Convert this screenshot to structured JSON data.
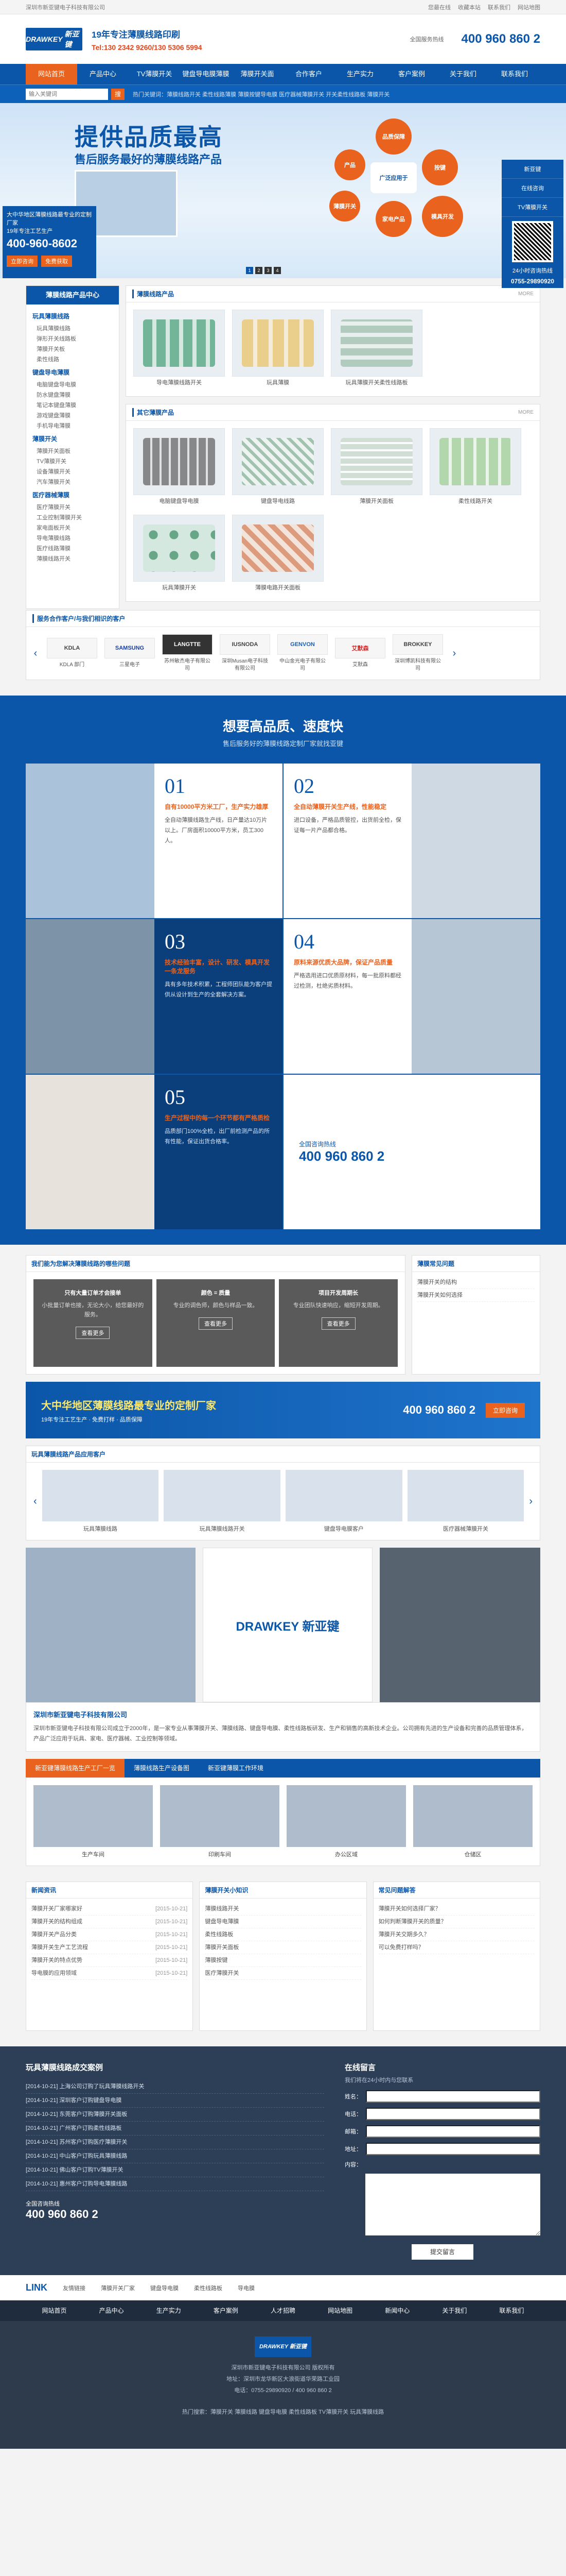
{
  "topbar": {
    "company": "深圳市新亚键电子科技有限公司",
    "links": [
      "您最在线",
      "收藏本站",
      "联系我们",
      "网站地图"
    ]
  },
  "header": {
    "logo": "DRAWKEY",
    "logo_cn": "新亚键",
    "slogan1": "19年专注薄膜线路印刷",
    "slogan2": "Tel:130 2342 9260/130 5306 5994",
    "phone_label": "全国服务热线",
    "phone": "400 960 860 2"
  },
  "nav": [
    "网站首页",
    "产品中心",
    "TV薄膜开关",
    "键盘导电膜薄膜",
    "薄膜开关面",
    "合作客户",
    "生产实力",
    "客户案例",
    "关于我们",
    "联系我们"
  ],
  "search": {
    "placeholder": "输入关键词",
    "button": "搜",
    "hot": "热门关键词：薄膜线路开关 柔性线路薄膜 薄膜按键导电膜 医疗器械薄膜开关 开关柔性线路板 薄膜开关"
  },
  "banner": {
    "title": "提供品质最高",
    "subtitle": "售后服务最好的薄膜线路产品",
    "circles": [
      "品质保障",
      "产品",
      "按键",
      "薄膜开关",
      "模具开发",
      "家电产品",
      "广泛应用于"
    ],
    "dots": [
      "1",
      "2",
      "3",
      "4"
    ]
  },
  "adbox": {
    "line1": "大中华地区薄膜线路最专业的定制厂家",
    "line2": "19年专注工艺生产",
    "phone": "400-960-8602",
    "btn1": "立即咨询",
    "btn2": "免费获取"
  },
  "side": {
    "items": [
      "新亚键",
      "在线咨询",
      "TV薄膜开关"
    ],
    "scan_label": "24小时咨询热线",
    "tel": "0755-29890920"
  },
  "leftcol": {
    "title": "薄膜线路产品中心",
    "groups": [
      {
        "title": "玩具薄膜线路",
        "items": [
          "玩具薄膜线路",
          "弹形开关线路板",
          "薄膜开关板",
          "柔性线路"
        ]
      },
      {
        "title": "键盘导电薄膜",
        "items": [
          "电脑键盘导电膜",
          "防水键盘薄膜",
          "笔记本键盘薄膜",
          "游戏键盘薄膜",
          "手机导电薄膜"
        ]
      },
      {
        "title": "薄膜开关",
        "items": [
          "薄膜开关面板",
          "TV薄膜开关",
          "设备薄膜开关",
          "汽车薄膜开关"
        ]
      },
      {
        "title": "医疗器械薄膜",
        "items": [
          "医疗薄膜开关",
          "工业控制薄膜开关",
          "家电面板开关",
          "导电薄膜线路",
          "医疗线路薄膜",
          "薄膜线路开关"
        ]
      }
    ]
  },
  "products1": {
    "title": "薄膜线路产品",
    "more": "MORE",
    "items": [
      "导电薄膜线路开关",
      "玩具薄膜",
      "玩具薄膜开关柔性线路板"
    ]
  },
  "products2": {
    "title": "其它薄膜产品",
    "more": "MORE",
    "items": [
      "电脑键盘导电膜",
      "键盘导电线路",
      "薄膜开关面板",
      "柔性线路开关",
      "玩具薄膜开关",
      "薄膜电路开关面板"
    ]
  },
  "partners": {
    "title": "服务合作客户/与我们相识的客户",
    "items": [
      {
        "logo": "KDLA",
        "name": "KDLA 部门"
      },
      {
        "logo": "SAMSUNG",
        "name": "三星电子"
      },
      {
        "logo": "LANGTTE",
        "name": "苏州敏杰电子有限公司"
      },
      {
        "logo": "IUSNODA",
        "name": "深圳Musan电子科技有限公司"
      },
      {
        "logo": "GENVON",
        "name": "中山金光电子有限公司"
      },
      {
        "logo": "艾默森",
        "name": "艾默森"
      },
      {
        "logo": "BROKKEY",
        "name": "深圳博凯科技有限公司"
      }
    ]
  },
  "quality": {
    "title": "想要高品质、速度快",
    "subtitle": "售后服务好的薄膜线路定制厂家就找亚键",
    "items": [
      {
        "num": "01",
        "title": "自有10000平方米工厂，生产实力雄厚",
        "desc": "全自动薄膜线路生产线，日产量达10万片以上。厂房面积10000平方米，员工300人。"
      },
      {
        "num": "02",
        "title": "全自动薄膜开关生产线，性能稳定",
        "desc": "进口设备，严格品质管控，出货前全检，保证每一片产品都合格。"
      },
      {
        "num": "03",
        "title": "技术经验丰富，设计、研发、模具开发一条龙服务",
        "desc": "具有多年技术积累，工程师团队能为客户提供从设计到生产的全套解决方案。"
      },
      {
        "num": "04",
        "title": "原料来源优质大品牌，保证产品质量",
        "desc": "严格选用进口优质原材料，每一批原料都经过检测，杜绝劣质材料。"
      },
      {
        "num": "05",
        "title": "生产过程中的每一个环节都有严格质检",
        "desc": "品质部门100%全检，出厂前检测产品的所有性能，保证出货合格率。"
      }
    ],
    "call_label": "全国咨询热线",
    "call_phone": "400 960 860 2"
  },
  "answers": {
    "title": "我们能为您解决薄膜线路的哪些问题",
    "items": [
      {
        "title": "只有大量订单才会接单",
        "desc": "小批量订单也接，无论大小，给您最好的服务。",
        "btn": "查看更多"
      },
      {
        "title": "颜色 = 质量",
        "desc": "专业的调色师，颜色与样品一致。",
        "btn": "查看更多"
      },
      {
        "title": "项目开发周期长",
        "desc": "专业团队快速响应，缩短开发周期。",
        "btn": "查看更多"
      }
    ]
  },
  "news_side": {
    "title": "薄膜常见问题",
    "items": [
      "薄膜开关的结构",
      "薄膜开关如何选择"
    ]
  },
  "strip": {
    "text": "大中华地区薄膜线路最专业的定制厂家",
    "sub": "19年专注工艺生产 · 免费打样 · 品质保障",
    "phone": "400 960 860 2",
    "btn": "立即咨询"
  },
  "cases": {
    "title": "玩具薄膜线路产品应用客户",
    "items": [
      "玩具薄膜线路",
      "玩具薄膜线路开关",
      "键盘导电膜客户",
      "医疗器械薄膜开关"
    ]
  },
  "about": {
    "title": "深圳市新亚键电子科技有限公司",
    "logo": "DRAWKEY 新亚键",
    "text": "深圳市新亚键电子科技有限公司成立于2000年，是一家专业从事薄膜开关、薄膜线路、键盘导电膜、柔性线路板研发、生产和销售的高新技术企业。公司拥有先进的生产设备和完善的品质管理体系，产品广泛应用于玩具、家电、医疗器械、工业控制等领域。"
  },
  "factory": {
    "tabs": [
      "新亚键薄膜线路生产工厂一览",
      "薄膜线路生产设备图",
      "新亚键薄膜工作环境"
    ],
    "items": [
      "生产车间",
      "印刷车间",
      "办公区域",
      "仓储区"
    ]
  },
  "news3": [
    {
      "title": "新闻资讯",
      "rows": [
        {
          "t": "薄膜开关厂家哪家好",
          "d": "[2015-10-21]"
        },
        {
          "t": "薄膜开关的结构组成",
          "d": "[2015-10-21]"
        },
        {
          "t": "薄膜开关产品分类",
          "d": "[2015-10-21]"
        },
        {
          "t": "薄膜开关生产工艺流程",
          "d": "[2015-10-21]"
        },
        {
          "t": "薄膜开关的特点优势",
          "d": "[2015-10-21]"
        },
        {
          "t": "导电膜的应用领域",
          "d": "[2015-10-21]"
        }
      ]
    },
    {
      "title": "薄膜开关小知识",
      "rows": [
        {
          "t": "薄膜线路开关",
          "d": ""
        },
        {
          "t": "键盘导电薄膜",
          "d": ""
        },
        {
          "t": "柔性线路板",
          "d": ""
        },
        {
          "t": "薄膜开关面板",
          "d": ""
        },
        {
          "t": "薄膜按键",
          "d": ""
        },
        {
          "t": "医疗薄膜开关",
          "d": ""
        }
      ]
    },
    {
      "title": "常见问题解答",
      "rows": [
        {
          "t": "薄膜开关如何选择厂家？",
          "d": ""
        },
        {
          "t": "如何判断薄膜开关的质量？",
          "d": ""
        },
        {
          "t": "薄膜开关交期多久？",
          "d": ""
        },
        {
          "t": "可以免费打样吗？",
          "d": ""
        }
      ]
    }
  ],
  "message": {
    "list_title": "玩具薄膜线路成交案例",
    "rows": [
      "[2014-10-21] 上海公司订购了玩具薄膜线路开关",
      "[2014-10-21] 深圳客户订购键盘导电膜",
      "[2014-10-21] 东莞客户订购薄膜开关面板",
      "[2014-10-21] 广州客户订购柔性线路板",
      "[2014-10-21] 苏州客户订购医疗薄膜开关",
      "[2014-10-21] 中山客户订购玩具薄膜线路",
      "[2014-10-21] 佛山客户订购TV薄膜开关",
      "[2014-10-21] 惠州客户订购导电薄膜线路"
    ],
    "form_title": "在线留言",
    "form_sub": "我们将在24小时内与您联系",
    "fields": [
      "姓名：",
      "电话：",
      "邮箱：",
      "地址：",
      "内容："
    ],
    "submit": "提交留言",
    "call_label": "全国咨询热线",
    "call_phone": "400 960 860 2"
  },
  "links": {
    "title": "LINK",
    "sub": "友情链接",
    "items": [
      "薄膜开关厂家",
      "键盘导电膜",
      "柔性线路板",
      "导电膜"
    ]
  },
  "footer": {
    "nav": [
      "网站首页",
      "产品中心",
      "生产实力",
      "客户案例",
      "人才招聘",
      "网站地图",
      "新闻中心",
      "关于我们",
      "联系我们"
    ],
    "logo": "DRAWKEY 新亚键",
    "lines": [
      "深圳市新亚键电子科技有限公司 版权所有",
      "地址：深圳市龙华新区大浪街道华荣路工业园",
      "电话：0755-29890920 / 400 960 860 2"
    ],
    "tags": "热门搜索：薄膜开关 薄膜线路 键盘导电膜 柔性线路板 TV薄膜开关 玩具薄膜线路"
  }
}
